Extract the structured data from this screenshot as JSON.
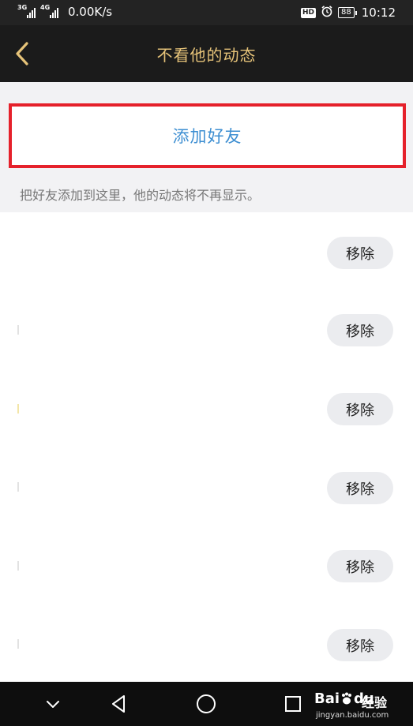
{
  "status_bar": {
    "network_1": "3G",
    "network_2": "4G",
    "speed": "0.00K/s",
    "hd": "HD",
    "battery": "88",
    "time": "10:12"
  },
  "header": {
    "title": "不看他的动态"
  },
  "add_friend": {
    "label": "添加好友"
  },
  "hint": "把好友添加到这里，他的动态将不再显示。",
  "list": {
    "items": [
      {
        "remove_label": "移除"
      },
      {
        "remove_label": "移除"
      },
      {
        "remove_label": "移除"
      },
      {
        "remove_label": "移除"
      },
      {
        "remove_label": "移除"
      },
      {
        "remove_label": "移除"
      }
    ]
  },
  "watermark": {
    "logo": "Bai",
    "logo_suffix": "du",
    "product": "经验",
    "url": "jingyan.baidu.com"
  },
  "colors": {
    "accent_gold": "#e6c379",
    "highlight_red": "#e5212b",
    "link_blue": "#3e8fd2"
  },
  "icons": {
    "back": "chevron-left-icon",
    "nav_collapse": "chevron-down-icon",
    "nav_back": "triangle-back-icon",
    "nav_home": "circle-home-icon",
    "nav_recent": "square-recent-icon"
  }
}
